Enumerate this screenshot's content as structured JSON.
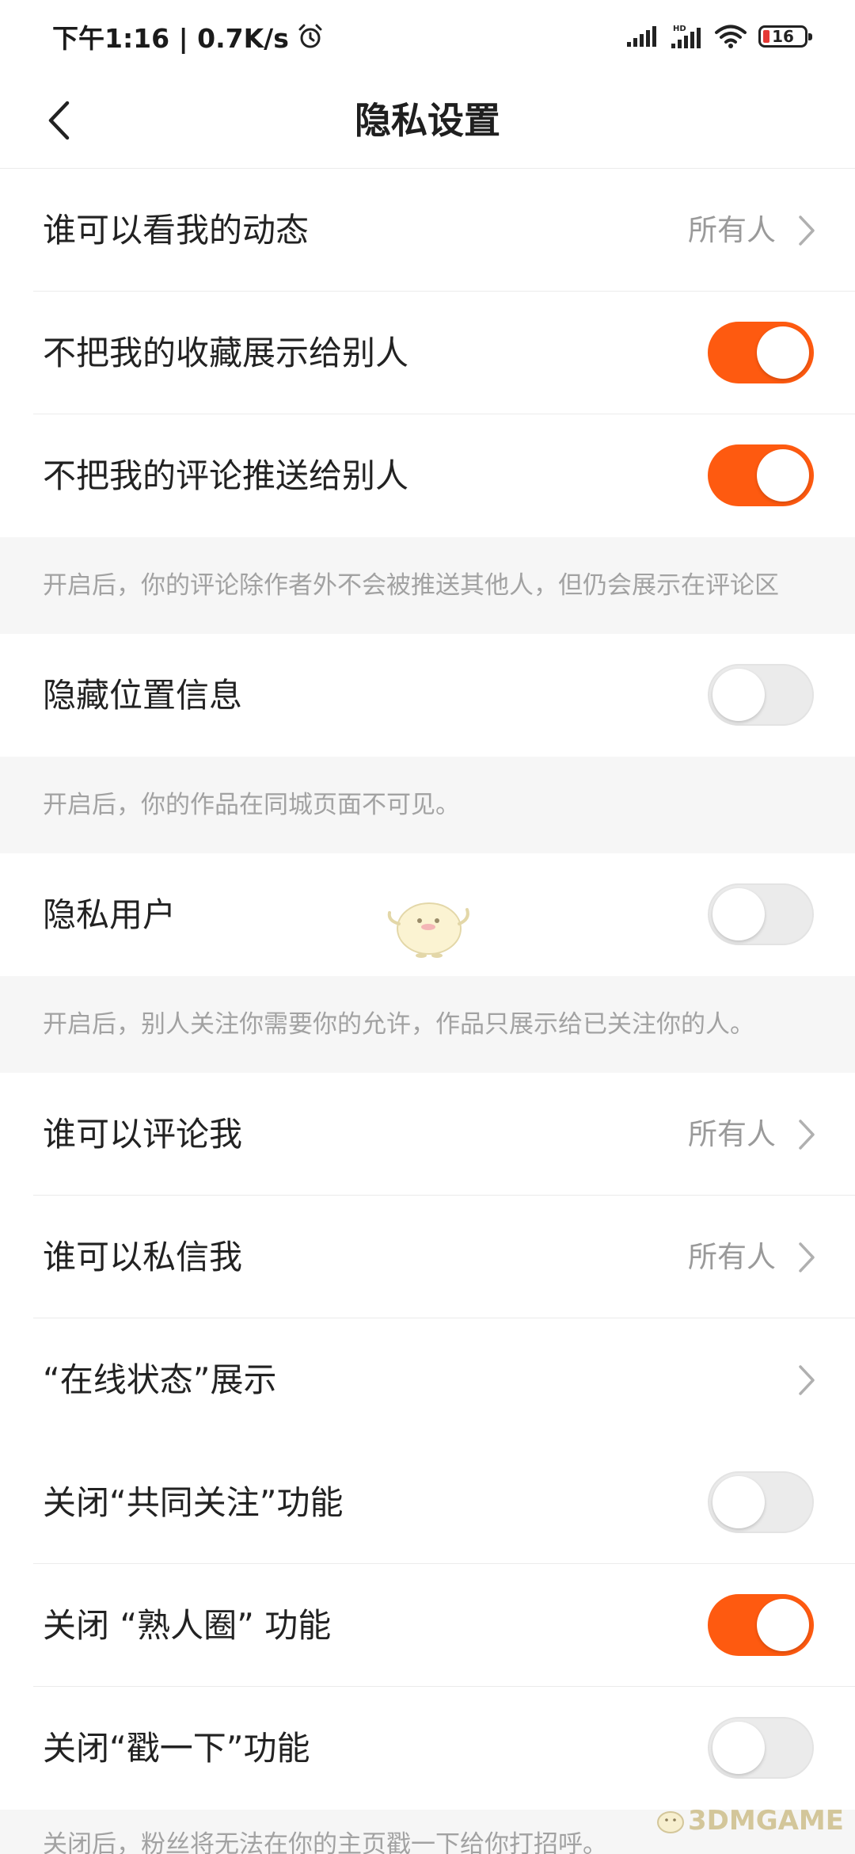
{
  "status_bar": {
    "time_speed": "下午1:16 | 0.7K/s",
    "battery": "16",
    "icons": [
      "alarm-icon",
      "signal-icon",
      "hd-signal-icon",
      "wifi-icon",
      "battery-icon"
    ]
  },
  "header": {
    "title": "隐私设置",
    "back_icon": "back-arrow-icon"
  },
  "rows": [
    {
      "label": "谁可以看我的动态",
      "value": "所有人"
    },
    {
      "label": "不把我的收藏展示给别人",
      "toggle": true
    },
    {
      "label": "不把我的评论推送给别人",
      "toggle": true
    },
    {
      "label": "隐藏位置信息",
      "toggle": false
    },
    {
      "label": "隐私用户",
      "toggle": false
    },
    {
      "label": "谁可以评论我",
      "value": "所有人"
    },
    {
      "label": "谁可以私信我",
      "value": "所有人"
    },
    {
      "label": "“在线状态”展示"
    },
    {
      "label": "关闭“共同关注”功能",
      "toggle": false
    },
    {
      "label": "关闭 “熟人圈” 功能",
      "toggle": true
    },
    {
      "label": "关闭“戳一下”功能",
      "toggle": false
    }
  ],
  "notes": [
    "开启后，你的评论除作者外不会被推送其他人，但仍会展示在评论区",
    "开启后，你的作品在同城页面不可见。",
    "开启后，别人关注你需要你的允许，作品只展示给已关注你的人。",
    "关闭后，粉丝将无法在你的主页戳一下给你打招呼。"
  ],
  "watermark": "3DMGAME",
  "colors": {
    "accent": "#fe5a10",
    "toggle_off": "#ebebeb",
    "note_bg": "#f6f6f6",
    "secondary_text": "#9a9a9a"
  }
}
